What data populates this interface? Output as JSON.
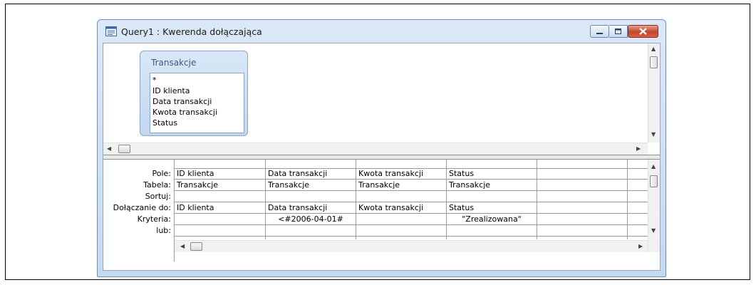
{
  "window": {
    "title": "Query1 : Kwerenda dołączająca",
    "title_icon": "query-icon"
  },
  "table": {
    "name": "Transakcje",
    "fields": [
      "*",
      "ID klienta",
      "Data transakcji",
      "Kwota transakcji",
      "Status"
    ]
  },
  "grid": {
    "row_labels": [
      "Pole:",
      "Tabela:",
      "Sortuj:",
      "Dołączanie do:",
      "Kryteria:",
      "lub:"
    ],
    "columns": [
      {
        "pole": "ID klienta",
        "tabela": "Transakcje",
        "sortuj": "",
        "dolaczanie": "ID klienta",
        "kryteria": "",
        "lub": ""
      },
      {
        "pole": "Data transakcji",
        "tabela": "Transakcje",
        "sortuj": "",
        "dolaczanie": "Data transakcji",
        "kryteria": "<#2006-04-01#",
        "lub": ""
      },
      {
        "pole": "Kwota transakcji",
        "tabela": "Transakcje",
        "sortuj": "",
        "dolaczanie": "Kwota transakcji",
        "kryteria": "",
        "lub": ""
      },
      {
        "pole": "Status",
        "tabela": "Transakcje",
        "sortuj": "",
        "dolaczanie": "Status",
        "kryteria": "\"Zrealizowana\"",
        "lub": ""
      },
      {
        "pole": "",
        "tabela": "",
        "sortuj": "",
        "dolaczanie": "",
        "kryteria": "",
        "lub": ""
      },
      {
        "pole": "",
        "tabela": "",
        "sortuj": "",
        "dolaczanie": "",
        "kryteria": "",
        "lub": ""
      }
    ]
  },
  "colors": {
    "window_frame": "#c6d9f0",
    "close_button": "#c2452a",
    "table_title": "#3d5a84"
  }
}
